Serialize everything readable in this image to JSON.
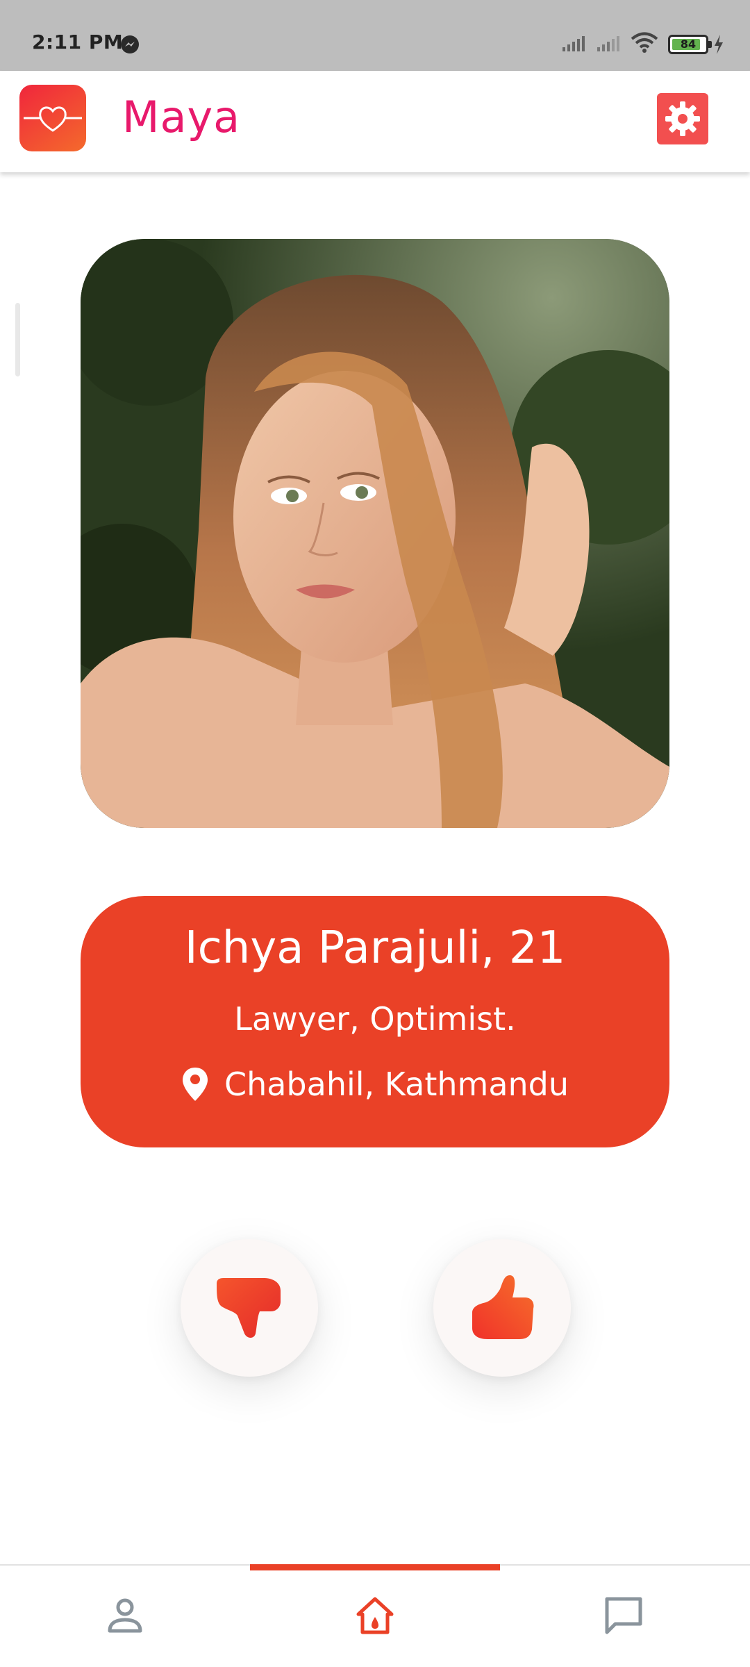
{
  "status_bar": {
    "time": "2:11 PM",
    "battery_level": "84",
    "icons": [
      "messenger-icon",
      "signal-icon",
      "signal-icon",
      "wifi-icon",
      "battery-icon",
      "charging-icon"
    ]
  },
  "app_bar": {
    "title": "Maya",
    "logo_icon": "heart-logo-icon",
    "settings_icon": "gear-icon"
  },
  "profile": {
    "photo_icon": "profile-photo",
    "name_age": "Ichya Parajuli, 21",
    "bio": "Lawyer, Optimist.",
    "location": "Chabahil, Kathmandu",
    "location_icon": "map-pin-icon"
  },
  "actions": {
    "dislike_icon": "thumbs-down-icon",
    "like_icon": "thumbs-up-icon"
  },
  "bottom_nav": {
    "items": [
      {
        "icon": "person-icon",
        "active": false
      },
      {
        "icon": "home-icon",
        "active": true
      },
      {
        "icon": "chat-icon",
        "active": false
      }
    ]
  },
  "colors": {
    "accent": "#ea4127",
    "title_pink": "#e8196b",
    "settings_red": "#f24f4f",
    "status_bar_bg": "#bdbdbd",
    "inactive_icon": "#8a949c"
  }
}
